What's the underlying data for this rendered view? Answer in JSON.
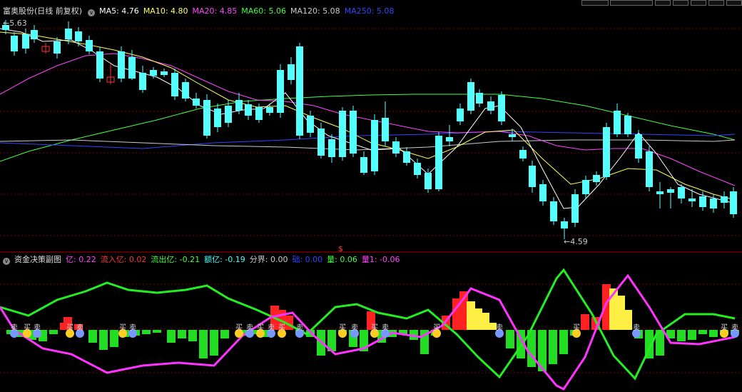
{
  "main_panel": {
    "stock_name": "富奥股份",
    "period": "(日线 前复权)",
    "indicators": [
      {
        "label": "MA5: 4.76",
        "color": "#ffffff"
      },
      {
        "label": "MA10: 4.80",
        "color": "#ffff55"
      },
      {
        "label": "MA20: 4.85",
        "color": "#ff44ff"
      },
      {
        "label": "MA60: 5.06",
        "color": "#44ff44"
      },
      {
        "label": "MA120: 5.08",
        "color": "#cccccc"
      },
      {
        "label": "MA250: 5.08",
        "color": "#3344ff"
      }
    ],
    "high_marker": "5.63",
    "low_marker": "4.59",
    "dollar_marker": "$"
  },
  "sub_panel": {
    "title": "资金决策副图",
    "indicators": [
      {
        "label": "亿: 0.22",
        "color": "#ff44ff"
      },
      {
        "label": "流入亿: 0.02",
        "color": "#ff3333"
      },
      {
        "label": "流出亿: -0.21",
        "color": "#44ff44"
      },
      {
        "label": "额亿: -0.19",
        "color": "#44ffff"
      },
      {
        "label": "分界: 0.00",
        "color": "#cccccc"
      },
      {
        "label": "础: 0.00",
        "color": "#3344ff"
      },
      {
        "label": "量: 0.06",
        "color": "#44ff44"
      },
      {
        "label": "量1: -0.06",
        "color": "#ff44ff"
      }
    ],
    "buy_label": "买",
    "sell_label": "卖"
  },
  "colors": {
    "background": "#000000",
    "up": "#ff3333",
    "down": "#54ffff",
    "grid": "#800000",
    "ma5": "#ffffff",
    "ma10": "#ffff55",
    "ma20": "#ff44ff",
    "ma60": "#44ff44",
    "ma120": "#cccccc",
    "ma250": "#3344ff"
  }
}
